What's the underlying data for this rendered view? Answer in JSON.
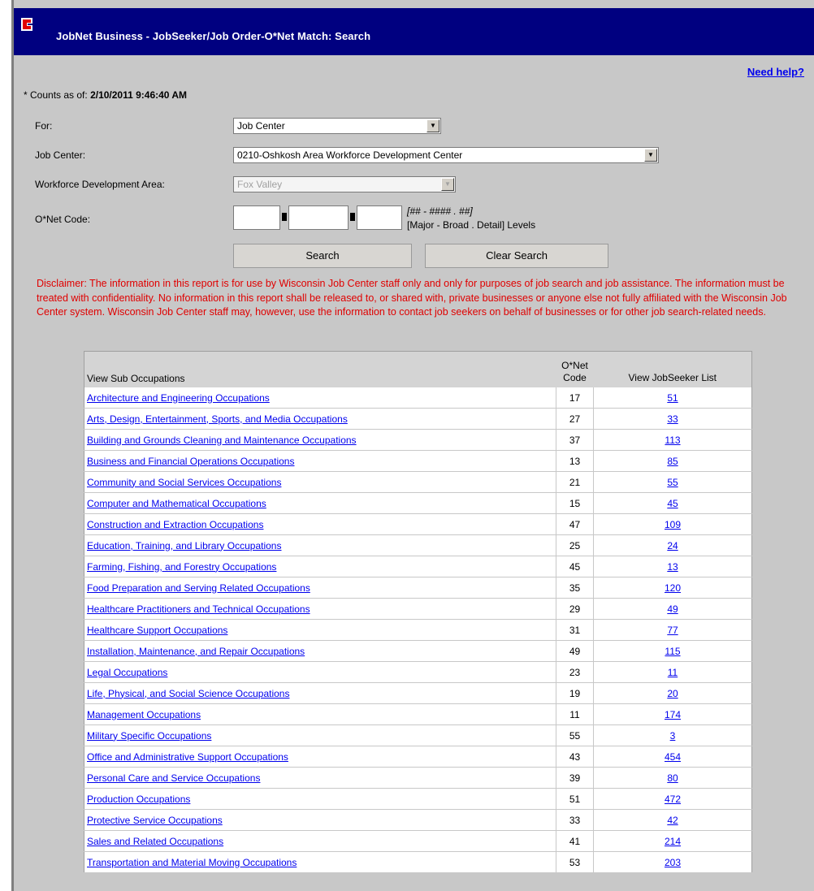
{
  "header": {
    "title": "JobNet Business - JobSeeker/Job Order-O*Net Match: Search"
  },
  "help_link": "Need help?",
  "counts": {
    "prefix": "* Counts as of:",
    "timestamp": "2/10/2011 9:46:40 AM"
  },
  "form": {
    "for_label": "For:",
    "for_value": "Job Center",
    "job_center_label": "Job Center:",
    "job_center_value": "0210-Oshkosh Area Workforce Development Center",
    "wda_label": "Workforce Development Area:",
    "wda_value": "Fox Valley",
    "onet_label": "O*Net Code:",
    "onet_format": "[## - #### . ##]",
    "onet_levels": "[Major - Broad . Detail] Levels",
    "search_button": "Search",
    "clear_button": "Clear Search"
  },
  "disclaimer": "Disclaimer: The information in this report is for use by Wisconsin Job Center staff only and only for purposes of job search and job assistance. The information must be treated with confidentiality. No information in this report shall be released to, or shared with, private businesses or anyone else not fully affiliated with the Wisconsin Job Center system. Wisconsin Job Center staff may, however, use the information to contact job seekers on behalf of businesses or for other job search-related needs.",
  "table": {
    "headers": {
      "occupations": "View Sub Occupations",
      "code_line1": "O*Net",
      "code_line2": "Code",
      "list": "View JobSeeker List"
    },
    "rows": [
      {
        "name": "Architecture and Engineering Occupations",
        "code": "17",
        "count": "51"
      },
      {
        "name": "Arts, Design, Entertainment, Sports, and Media Occupations",
        "code": "27",
        "count": "33"
      },
      {
        "name": "Building and Grounds Cleaning and Maintenance Occupations",
        "code": "37",
        "count": "113"
      },
      {
        "name": "Business and Financial Operations Occupations",
        "code": "13",
        "count": "85"
      },
      {
        "name": "Community and Social Services Occupations",
        "code": "21",
        "count": "55"
      },
      {
        "name": "Computer and Mathematical Occupations",
        "code": "15",
        "count": "45"
      },
      {
        "name": "Construction and Extraction Occupations",
        "code": "47",
        "count": "109"
      },
      {
        "name": "Education, Training, and Library Occupations",
        "code": "25",
        "count": "24"
      },
      {
        "name": "Farming, Fishing, and Forestry Occupations",
        "code": "45",
        "count": "13"
      },
      {
        "name": "Food Preparation and Serving Related Occupations",
        "code": "35",
        "count": "120"
      },
      {
        "name": "Healthcare Practitioners and Technical Occupations",
        "code": "29",
        "count": "49"
      },
      {
        "name": "Healthcare Support Occupations",
        "code": "31",
        "count": "77"
      },
      {
        "name": "Installation, Maintenance, and Repair Occupations",
        "code": "49",
        "count": "115"
      },
      {
        "name": "Legal Occupations",
        "code": "23",
        "count": "11"
      },
      {
        "name": "Life, Physical, and Social Science Occupations",
        "code": "19",
        "count": "20"
      },
      {
        "name": "Management Occupations",
        "code": "11",
        "count": "174"
      },
      {
        "name": "Military Specific Occupations",
        "code": "55",
        "count": "3"
      },
      {
        "name": "Office and Administrative Support Occupations",
        "code": "43",
        "count": "454"
      },
      {
        "name": "Personal Care and Service Occupations",
        "code": "39",
        "count": "80"
      },
      {
        "name": "Production Occupations",
        "code": "51",
        "count": "472"
      },
      {
        "name": "Protective Service Occupations",
        "code": "33",
        "count": "42"
      },
      {
        "name": "Sales and Related Occupations",
        "code": "41",
        "count": "214"
      },
      {
        "name": "Transportation and Material Moving Occupations",
        "code": "53",
        "count": "203"
      }
    ]
  }
}
